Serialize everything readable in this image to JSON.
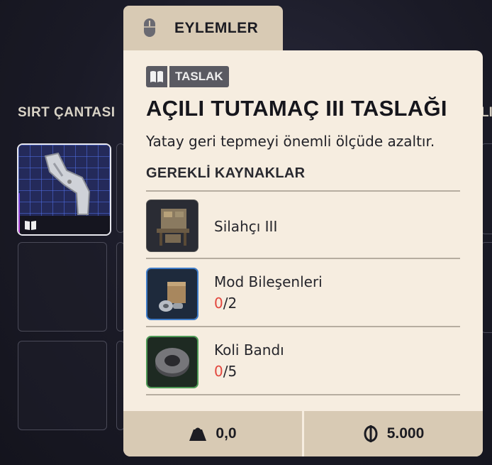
{
  "backpack": {
    "title": "SIRT ÇANTASI",
    "right_title_fragment": "LI"
  },
  "actions_tab": {
    "label": "EYLEMLER",
    "icon": "mouse-icon"
  },
  "card": {
    "tag": {
      "icon": "book-icon",
      "label": "TASLAK"
    },
    "title": "AÇILI TUTAMAÇ III TASLAĞI",
    "description": "Yatay geri tepmeyi önemli ölçüde azaltır.",
    "requirements_heading": "GEREKLİ KAYNAKLAR",
    "requirements": [
      {
        "name": "Silahçı III",
        "icon": "workbench-icon",
        "rarity_color": "#555555"
      },
      {
        "name": "Mod Bileşenleri",
        "have": "0",
        "need": "/2",
        "icon": "mod-components-icon",
        "rarity_color": "#3f7cc8"
      },
      {
        "name": "Koli Bandı",
        "have": "0",
        "need": "/5",
        "icon": "duct-tape-icon",
        "rarity_color": "#4e9a56"
      }
    ],
    "footer": {
      "weight": {
        "icon": "weight-icon",
        "value": "0,0"
      },
      "price": {
        "icon": "coin-icon",
        "value": "5.000"
      }
    }
  },
  "colors": {
    "card_bg": "#f6ede0",
    "tab_bg": "#d8cab4",
    "missing_count": "#e2463d"
  }
}
